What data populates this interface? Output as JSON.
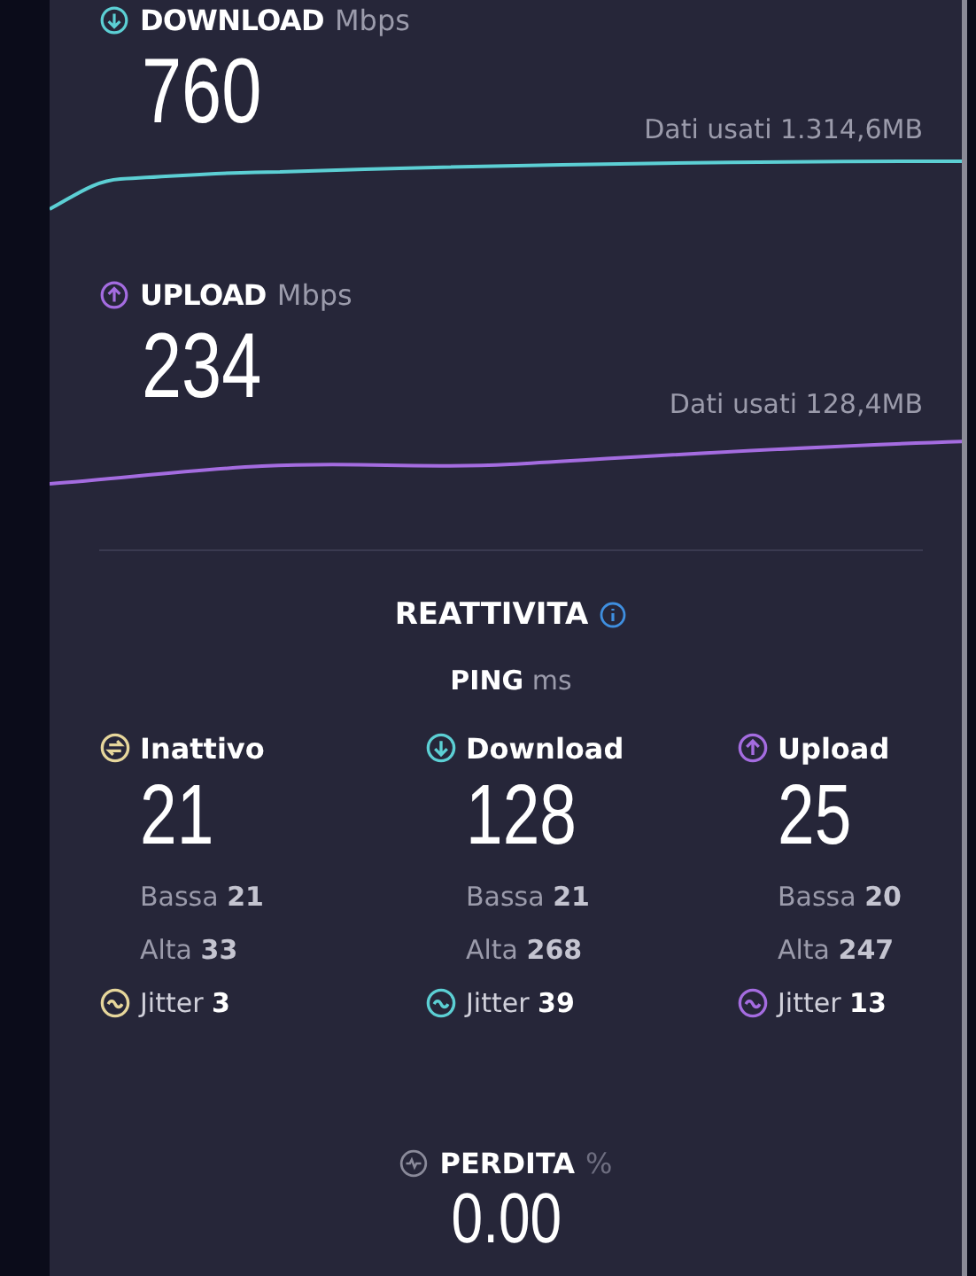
{
  "speeds": [
    {
      "kind": "download",
      "label": "DOWNLOAD",
      "unit": "Mbps",
      "value": "760",
      "data_used": "Dati usati 1.314,6MB",
      "color": "#5ccfd4"
    },
    {
      "kind": "upload",
      "label": "UPLOAD",
      "unit": "Mbps",
      "value": "234",
      "data_used": "Dati usati 128,4MB",
      "color": "#a46ce0"
    }
  ],
  "responsiveness": {
    "title": "REATTIVITA",
    "ping_label": "PING",
    "ping_unit": "ms",
    "columns": [
      {
        "kind": "idle",
        "label": "Inattivo",
        "value": "21",
        "low": "Bassa **21**",
        "high": "Alta **33**",
        "jitter": "Jitter **3**",
        "color": "#e6d69b"
      },
      {
        "kind": "download",
        "label": "Download",
        "value": "128",
        "low": "Bassa **21**",
        "high": "Alta **268**",
        "jitter": "Jitter **39**",
        "color": "#5ccfd4"
      },
      {
        "kind": "upload",
        "label": "Upload",
        "value": "25",
        "low": "Bassa **20**",
        "high": "Alta **247**",
        "jitter": "Jitter **13**",
        "color": "#a46ce0"
      }
    ]
  },
  "loss": {
    "label": "PERDITA",
    "unit": "%",
    "value": "0.00"
  }
}
